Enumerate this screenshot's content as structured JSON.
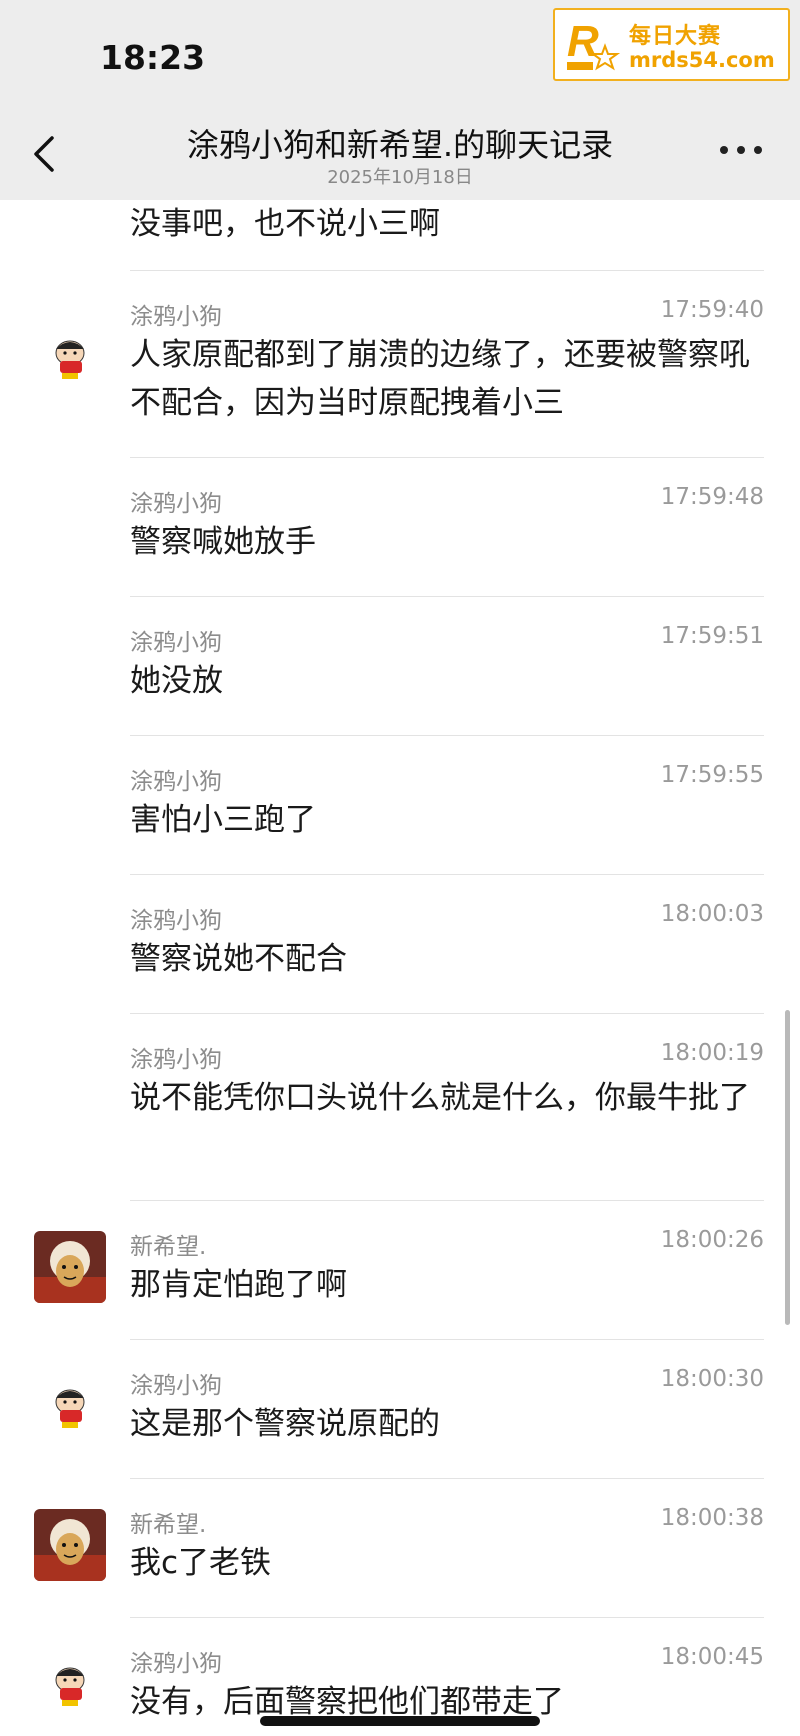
{
  "status_bar": {
    "time": "18:23"
  },
  "watermark": {
    "line1": "每日大赛",
    "line2": "mrds54.com",
    "badge": "每日大赛",
    "brand_color": "#f0a200"
  },
  "nav": {
    "back_icon": "chevron-left-icon",
    "title": "涂鸦小狗和新希望.的聊天记录",
    "subtitle": "2025年10月18日",
    "more_icon": "more-dots-icon"
  },
  "messages": [
    {
      "sender": "",
      "time": "",
      "text": "没事吧，也不说小三啊"
    },
    {
      "sender": "涂鸦小狗",
      "time": "17:59:40",
      "text": "人家原配都到了崩溃的边缘了，还要被警察吼不配合，因为当时原配拽着小三"
    },
    {
      "sender": "涂鸦小狗",
      "time": "17:59:48",
      "text": "警察喊她放手"
    },
    {
      "sender": "涂鸦小狗",
      "time": "17:59:51",
      "text": "她没放"
    },
    {
      "sender": "涂鸦小狗",
      "time": "17:59:55",
      "text": "害怕小三跑了"
    },
    {
      "sender": "涂鸦小狗",
      "time": "18:00:03",
      "text": "警察说她不配合"
    },
    {
      "sender": "涂鸦小狗",
      "time": "18:00:19",
      "text": "说不能凭你口头说什么就是什么，你最牛批了"
    },
    {
      "sender": "新希望.",
      "time": "18:00:26",
      "text": "那肯定怕跑了啊"
    },
    {
      "sender": "涂鸦小狗",
      "time": "18:00:30",
      "text": "这是那个警察说原配的"
    },
    {
      "sender": "新希望.",
      "time": "18:00:38",
      "text": "我c了老铁"
    },
    {
      "sender": "涂鸦小狗",
      "time": "18:00:45",
      "text": "没有，后面警察把他们都带走了"
    }
  ]
}
